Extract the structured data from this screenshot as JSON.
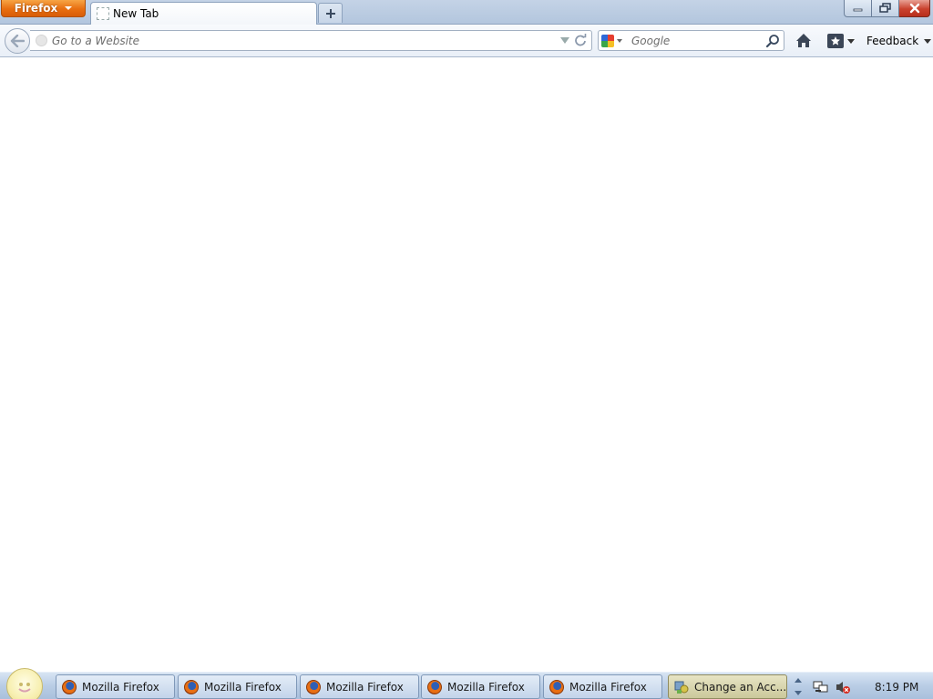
{
  "browser": {
    "menu_button_label": "Firefox",
    "tabs": [
      {
        "label": "New Tab"
      }
    ],
    "urlbar": {
      "placeholder": "Go to a Website",
      "value": ""
    },
    "searchbar": {
      "engine_icon": "google-icon",
      "placeholder": "Google",
      "value": ""
    },
    "toolbar": {
      "home_icon": "home-icon",
      "bookmarks_icon": "bookmarks-star-icon",
      "feedback_label": "Feedback"
    },
    "window_controls": [
      "minimize-icon",
      "restore-icon",
      "close-icon"
    ]
  },
  "taskbar": {
    "buttons": [
      {
        "label": "Mozilla Firefox",
        "icon": "firefox-icon"
      },
      {
        "label": "Mozilla Firefox",
        "icon": "firefox-icon"
      },
      {
        "label": "Mozilla Firefox",
        "icon": "firefox-icon"
      },
      {
        "label": "Mozilla Firefox",
        "icon": "firefox-icon"
      },
      {
        "label": "Mozilla Firefox",
        "icon": "firefox-icon"
      },
      {
        "label": "Change an Acc...",
        "icon": "control-panel-icon",
        "active": true
      }
    ],
    "tray": {
      "icons": [
        "network-icon",
        "volume-muted-icon"
      ],
      "clock": "8:19 PM"
    }
  },
  "colors": {
    "firefox_button": "#e86e10",
    "close_button": "#c9412d",
    "taskbar": "#b9cde5"
  }
}
